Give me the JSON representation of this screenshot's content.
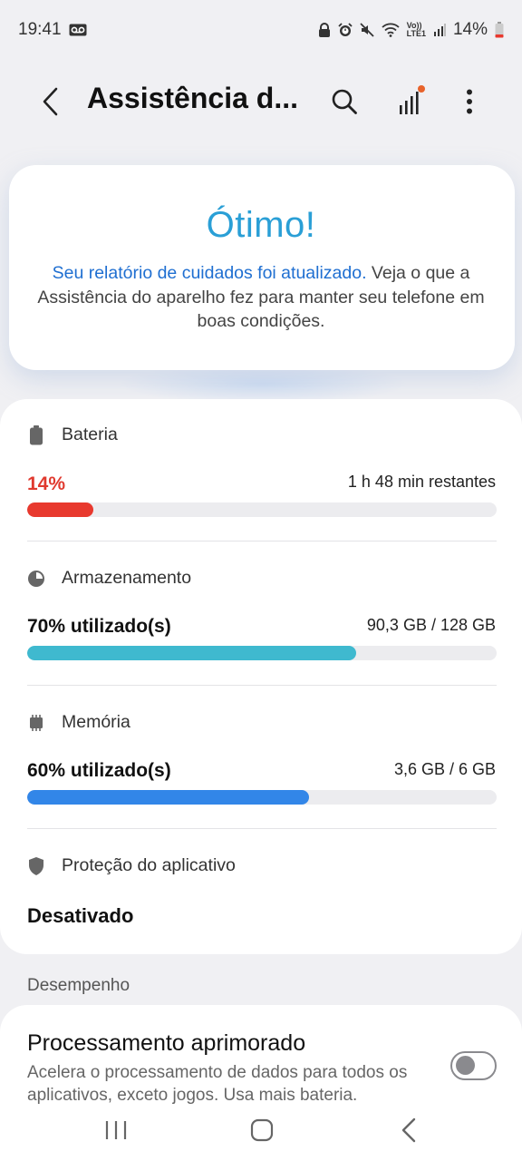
{
  "status_bar": {
    "time": "19:41",
    "battery_percent": "14%",
    "icons": [
      "voicemail-icon",
      "lock-icon",
      "alarm-icon",
      "mute-icon",
      "wifi-icon",
      "volte-icon",
      "signal-icon",
      "battery-icon"
    ],
    "volte_text": "Vo))\nLTE1"
  },
  "app_bar": {
    "title": "Assistência d...",
    "actions": [
      "search-icon",
      "signal-bars-icon",
      "more-vert-icon"
    ],
    "notification_dot_color": "#e8632b"
  },
  "hero": {
    "title": "Ótimo!",
    "link_text": "Seu relatório de cuidados foi atualizado.",
    "text": " Veja o que a Assistência do aparelho fez para manter seu telefone em boas condições."
  },
  "battery": {
    "label": "Bateria",
    "value": "14%",
    "remaining": "1 h 48 min restantes",
    "level": 0.14,
    "color": "#e8392e"
  },
  "storage": {
    "label": "Armazenamento",
    "value": "70% utilizado(s)",
    "detail": "90,3 GB / 128 GB",
    "level": 0.7,
    "color": "#3fb9cf"
  },
  "memory": {
    "label": "Memória",
    "value": "60% utilizado(s)",
    "detail": "3,6 GB / 6 GB",
    "level": 0.6,
    "color": "#3286e8"
  },
  "app_protection": {
    "label": "Proteção do aplicativo",
    "value": "Desativado"
  },
  "performance": {
    "section_title": "Desempenho",
    "item_title": "Processamento aprimorado",
    "item_desc": "Acelera o processamento de dados para todos os aplicativos, exceto jogos. Usa mais bateria.",
    "toggle_on": false
  },
  "nav_bar": [
    "recents-icon",
    "home-icon",
    "back-icon"
  ]
}
